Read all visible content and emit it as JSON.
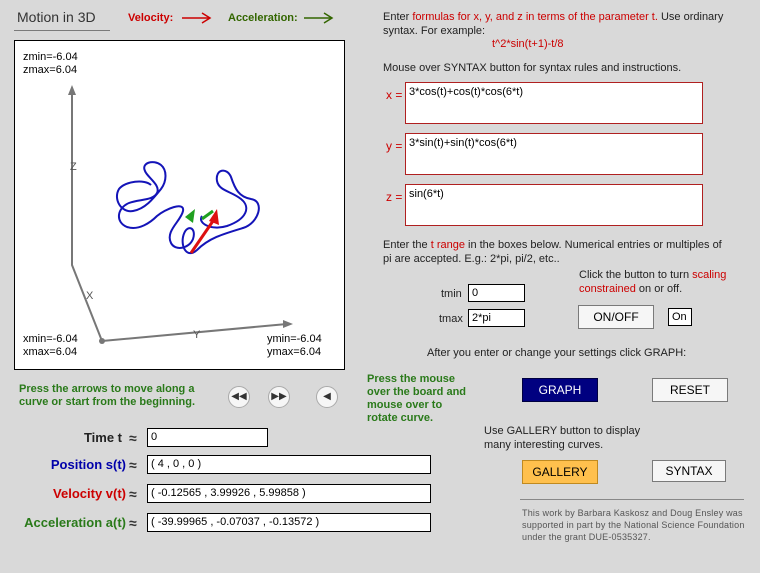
{
  "header": {
    "title": "Motion in 3D",
    "velocity_label": "Velocity:",
    "acceleration_label": "Acceleration:",
    "velocity_color": "#cc0000",
    "acceleration_color": "#336600"
  },
  "board": {
    "zmin": "zmin=-6.04",
    "zmax": "zmax=6.04",
    "xmin": "xmin=-6.04",
    "xmax": "xmax=6.04",
    "ymin": "ymin=-6.04",
    "ymax": "ymax=6.04",
    "axis_x": "X",
    "axis_y": "Y",
    "axis_z": "Z"
  },
  "instructions": {
    "enter_prefix": "Enter ",
    "enter_highlight": "formulas for x, y, and z in terms of the parameter t.",
    "enter_suffix": " Use ordinary syntax. For example:",
    "example": "t^2*sin(t+1)-t/8",
    "syntax_hint": "Mouse over SYNTAX button for syntax rules and instructions."
  },
  "formulas": {
    "x_label": "x =",
    "x_value": "3*cos(t)+cos(t)*cos(6*t)",
    "y_label": "y =",
    "y_value": "3*sin(t)+sin(t)*cos(6*t)",
    "z_label": "z =",
    "z_value": "sin(6*t)"
  },
  "range": {
    "text_prefix": "Enter the ",
    "text_highlight": "t range",
    "text_suffix": " in the boxes below. Numerical entries or multiples of pi are accepted. E.g.: 2*pi, pi/2, etc..",
    "tmin_label": "tmin",
    "tmin_value": "0",
    "tmax_label": "tmax",
    "tmax_value": "2*pi"
  },
  "scaling": {
    "text_prefix": "Click the button to turn ",
    "text_highlight": "scaling constrained",
    "text_suffix": " on or off.",
    "button_label": "ON/OFF",
    "state": "On"
  },
  "graph": {
    "hint": "After you enter or change your settings click GRAPH:",
    "graph_label": "GRAPH",
    "reset_label": "RESET"
  },
  "gallery": {
    "hint": "Use GALLERY button to display many interesting curves.",
    "gallery_label": "GALLERY",
    "syntax_label": "SYNTAX"
  },
  "notes": {
    "arrows": "Press the arrows to move along a curve or start from the beginning.",
    "rotate": "Press the mouse over the board and mouse over to rotate curve."
  },
  "stats": {
    "time_label": "Time t",
    "time_value": "0",
    "position_label": "Position s(t)",
    "position_value": "( 4 , 0 , 0 )",
    "velocity_label": "Velocity v(t)",
    "velocity_value": "( -0.12565 , 3.99926 , 5.99858 )",
    "acceleration_label": "Acceleration a(t)",
    "acceleration_value": "( -39.99965 , -0.07037 , -0.13572 )",
    "approx": "≈",
    "position_color": "#0000aa",
    "velocity_color": "#cc0000",
    "acceleration_color": "#2a7a1a"
  },
  "credit": {
    "text": "This work by Barbara Kaskosz and Doug Ensley was supported in part by the National Science Foundation under the grant DUE-0535327."
  }
}
